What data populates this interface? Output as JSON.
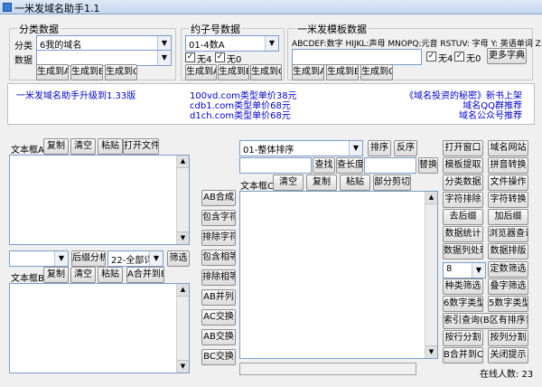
{
  "window": {
    "title": "一米发域名助手1.1"
  },
  "group_category": {
    "legend": "分类数据",
    "category_label": "分类",
    "category_value": "6我的域名",
    "data_label": "数据",
    "data_value": "",
    "buttons": [
      "生成到A",
      "生成到B",
      "生成到C"
    ]
  },
  "group_length": {
    "legend": "约子号数据",
    "select_value": "01-4数A",
    "chk1_label": "无4",
    "chk2_label": "无0",
    "chk1_checked": true,
    "chk2_checked": true,
    "buttons": [
      "生成到A",
      "生成到B",
      "生成到C"
    ]
  },
  "group_template": {
    "legend": "一米发模板数据",
    "hint": "ABCDEF:数字 HIJKL:声母 MNOPQ:元音 RSTUV: 字母 Y: 英语单词 Z: 拼音",
    "input_value": "",
    "chk1_label": "无4",
    "chk2_label": "无0",
    "chk1_checked": true,
    "chk2_checked": true,
    "more_dict": "更多字典",
    "buttons": [
      "生成到A",
      "生成到B",
      "生成到C"
    ]
  },
  "news": {
    "left": "一米发域名助手升级到1.33版",
    "center": [
      "100vd.com类型单价38元",
      "cdb1.com类型单价68元",
      "d1ch.com类型单价68元"
    ],
    "right": [
      "《域名投资的秘密》新书上架",
      "域名QQ群推荐",
      "域名公众号推荐"
    ]
  },
  "panelA": {
    "label": "文本框A",
    "buttons": [
      "复制",
      "清空",
      "粘贴",
      "打开文件"
    ],
    "filter_select": "",
    "analysis_button": "后缀分析",
    "detail_select": "22-全部详细",
    "filter_button": "筛选"
  },
  "panelB": {
    "label": "文本框B",
    "buttons": [
      "复制",
      "清空",
      "粘贴",
      "A合并到B"
    ]
  },
  "middle_buttons": [
    "AB合成",
    "包含字符",
    "排除字符",
    "包含相等",
    "排除相等",
    "AB并列",
    "AC交换",
    "AB交换",
    "BC交换"
  ],
  "panelC": {
    "sort_select": "01-整体排序",
    "sort_button": "排序",
    "reverse_button": "反序",
    "search_value": "",
    "search_button": "查找",
    "check_len_button": "查长度",
    "replace_value": "",
    "replace_button": "替换",
    "label": "文本框C",
    "buttons": [
      "清空",
      "复制",
      "粘贴",
      "部分剪切"
    ]
  },
  "right_buttons": [
    [
      "打开窗口",
      "域名网站"
    ],
    [
      "模板提取",
      "拼音转换"
    ],
    [
      "分类数据",
      "文件操作"
    ],
    [
      "字符排除",
      "字符转换"
    ],
    [
      "去后缀",
      "加后缀"
    ],
    [
      "数据统计",
      "浏览器查询"
    ],
    [
      "数据列处理",
      "数据排版"
    ]
  ],
  "right_lower": {
    "number_select": "8",
    "fixed_filter": "定数筛选",
    "row2": [
      "种类筛选",
      "叠字筛选"
    ],
    "row3": [
      "6数字类型",
      "5数字类型"
    ],
    "wide_button": "索引查询(B区有排序索引)",
    "row5": [
      "按行分割",
      "按列分割"
    ],
    "row6": [
      "B合并到C",
      "关闭提示"
    ]
  },
  "status": {
    "online": "在线人数: 23"
  }
}
